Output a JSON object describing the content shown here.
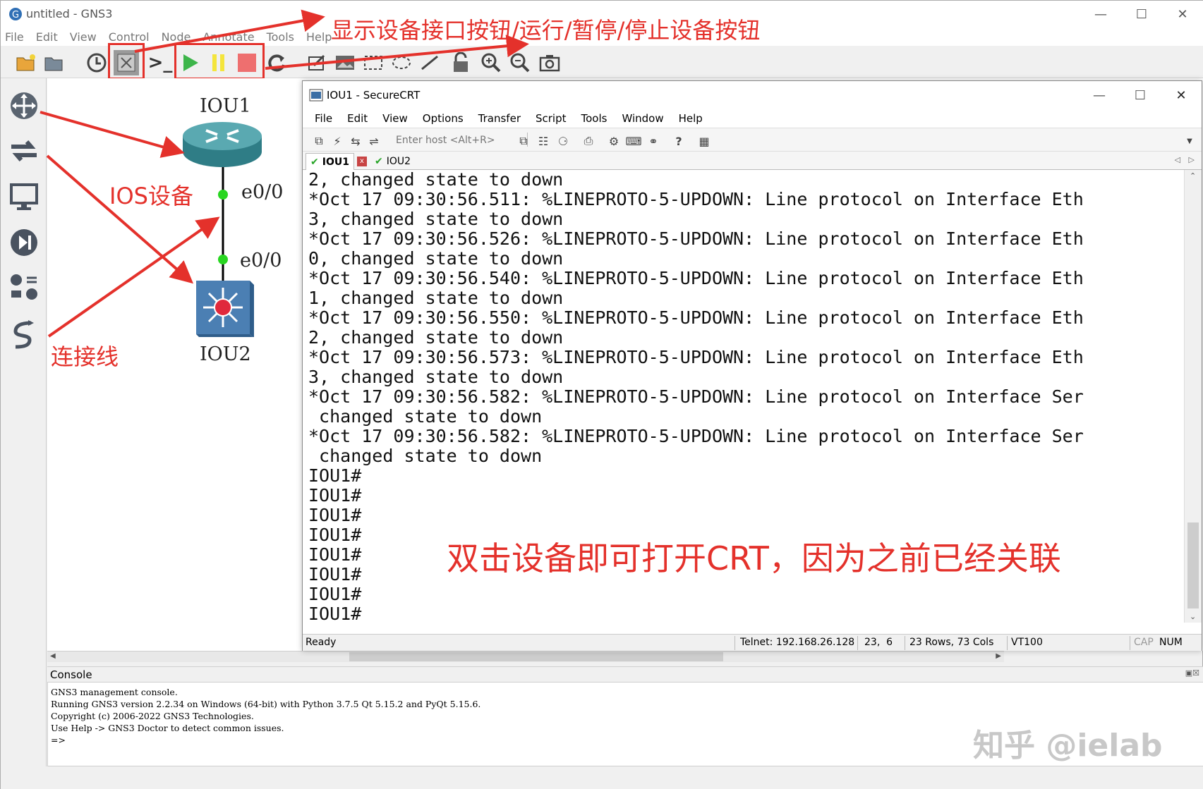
{
  "gns3": {
    "window_title": "untitled - GNS3",
    "menu": [
      "File",
      "Edit",
      "View",
      "Control",
      "Node",
      "Annotate",
      "Tools",
      "Help"
    ],
    "console": {
      "title": "Console",
      "lines": [
        "GNS3 management console.",
        "Running GNS3 version 2.2.34 on Windows (64-bit) with Python 3.7.5 Qt 5.15.2 and PyQt 5.15.6.",
        "Copyright (c) 2006-2022 GNS3 Technologies.",
        "Use Help -> GNS3 Doctor to detect common issues.",
        "",
        "=>"
      ]
    }
  },
  "topology": {
    "node1": {
      "name": "IOU1"
    },
    "node2": {
      "name": "IOU2"
    },
    "iface1": "e0/0",
    "iface2": "e0/0"
  },
  "annotations": {
    "toolbar_note": "显示设备接口按钮/运行/暂停/停止设备按钮",
    "ios_device": "IOS设备",
    "link": "连接线",
    "crt_note": "双击设备即可打开CRT，因为之前已经关联",
    "watermark": "知乎 @ielab",
    "color": "#e4312b"
  },
  "securecrt": {
    "title": "IOU1 - SecureCRT",
    "menu": [
      "File",
      "Edit",
      "View",
      "Options",
      "Transfer",
      "Script",
      "Tools",
      "Window",
      "Help"
    ],
    "host_placeholder": "Enter host <Alt+R>",
    "tabs": [
      {
        "label": "IOU1",
        "active": true
      },
      {
        "label": "IOU2",
        "active": false
      }
    ],
    "terminal_lines": [
      "2, changed state to down",
      "*Oct 17 09:30:56.511: %LINEPROTO-5-UPDOWN: Line protocol on Interface Eth",
      "3, changed state to down",
      "*Oct 17 09:30:56.526: %LINEPROTO-5-UPDOWN: Line protocol on Interface Eth",
      "0, changed state to down",
      "*Oct 17 09:30:56.540: %LINEPROTO-5-UPDOWN: Line protocol on Interface Eth",
      "1, changed state to down",
      "*Oct 17 09:30:56.550: %LINEPROTO-5-UPDOWN: Line protocol on Interface Eth",
      "2, changed state to down",
      "*Oct 17 09:30:56.573: %LINEPROTO-5-UPDOWN: Line protocol on Interface Eth",
      "3, changed state to down",
      "*Oct 17 09:30:56.582: %LINEPROTO-5-UPDOWN: Line protocol on Interface Ser",
      " changed state to down",
      "*Oct 17 09:30:56.582: %LINEPROTO-5-UPDOWN: Line protocol on Interface Ser",
      " changed state to down",
      "IOU1#",
      "IOU1#",
      "IOU1#",
      "IOU1#",
      "IOU1#",
      "IOU1#",
      "IOU1#",
      "IOU1#"
    ],
    "status": {
      "ready": "Ready",
      "connection": "Telnet: 192.168.26.128",
      "cursor": "23,  6",
      "size": "23 Rows, 73 Cols",
      "emulation": "VT100",
      "cap": "CAP",
      "num": "NUM"
    }
  }
}
